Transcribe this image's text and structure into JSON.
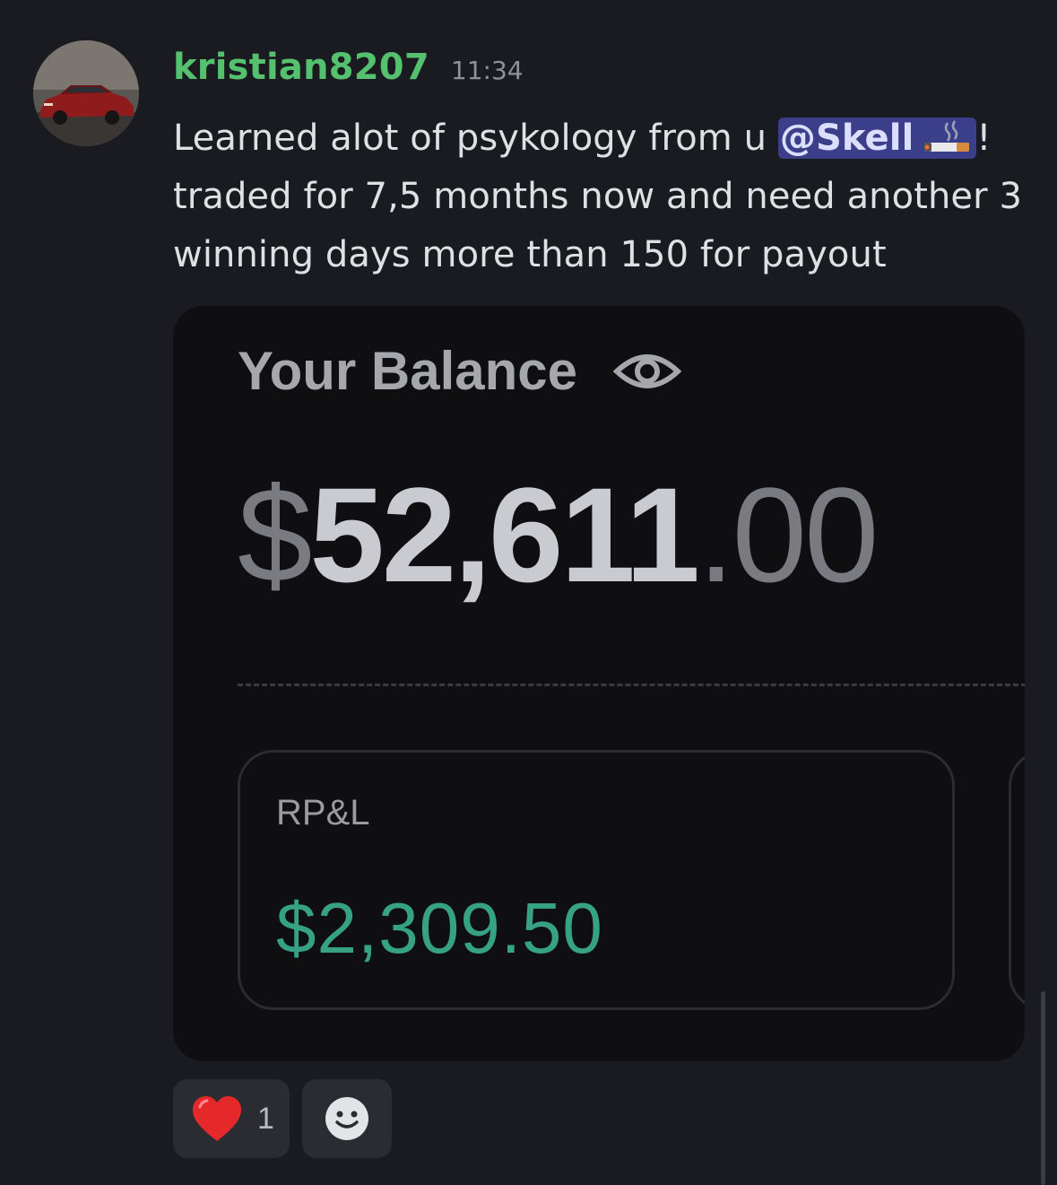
{
  "message": {
    "username": "kristian8207",
    "timestamp": "11:34",
    "text_before_mention": "Learned alot of psykology from u ",
    "mention": "@Skell",
    "mention_emoji": "cigarette-icon",
    "text_after_mention": "! traded for 7,5 months now and need another 3 winning days more than 150 for payout"
  },
  "embed": {
    "balance_label": "Your Balance",
    "balance_dollar": "$",
    "balance_main": "52,611",
    "balance_cents": ".00",
    "pnl_label": "RP&L",
    "pnl_value": "$2,309.50"
  },
  "reactions": [
    {
      "emoji": "heart-icon",
      "count": "1"
    },
    {
      "emoji": "add-reaction-icon"
    }
  ],
  "colors": {
    "username": "#55c16f",
    "mention_bg": "#3b3f8a",
    "pnl_positive": "#37a184",
    "background": "#1a1b20"
  }
}
